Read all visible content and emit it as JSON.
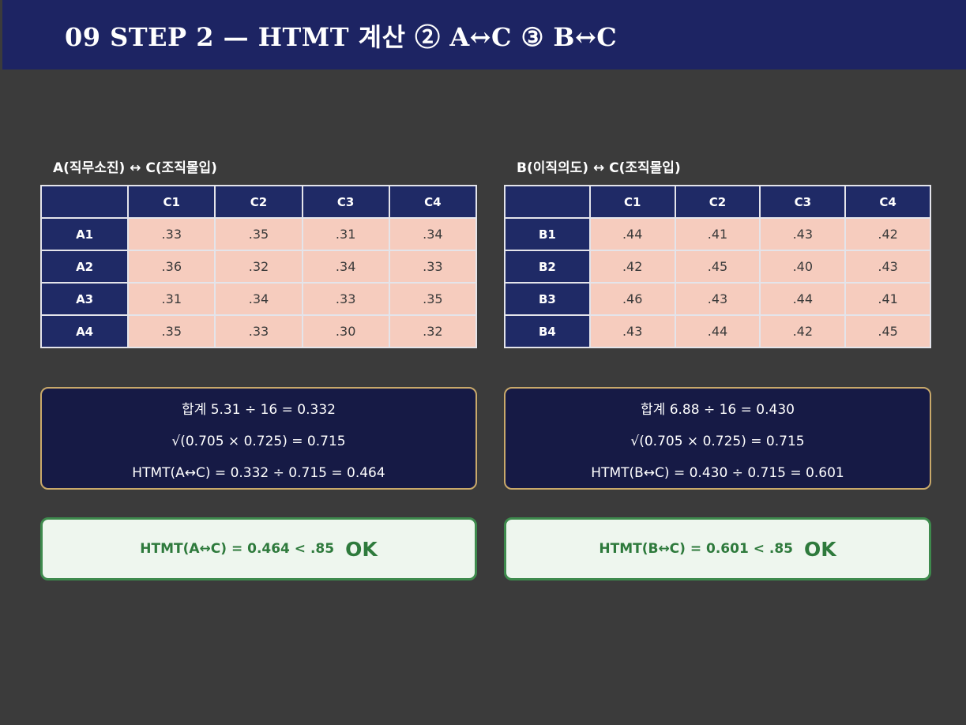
{
  "header": {
    "title": "09  STEP 2 — HTMT 계산 ②  A↔C   ③ B↔C",
    "background": "#1d2463"
  },
  "panels": [
    {
      "title": "A(직무소진) ↔ C(조직몰입)",
      "columns": [
        "",
        "C1",
        "C2",
        "C3",
        "C4"
      ],
      "rows": [
        {
          "label": "A1",
          "values": [
            ".33",
            ".35",
            ".31",
            ".34"
          ]
        },
        {
          "label": "A2",
          "values": [
            ".36",
            ".32",
            ".34",
            ".33"
          ]
        },
        {
          "label": "A3",
          "values": [
            ".31",
            ".34",
            ".33",
            ".35"
          ]
        },
        {
          "label": "A4",
          "values": [
            ".35",
            ".33",
            ".30",
            ".32"
          ]
        }
      ],
      "calc": [
        "합계 5.31  ÷  16 = 0.332",
        "√(0.705 × 0.725) = 0.715",
        "HTMT(A↔C) = 0.332 ÷ 0.715 = 0.464"
      ],
      "verdict": "HTMT(A↔C) = 0.464  <  .85",
      "ok": "OK"
    },
    {
      "title": "B(이직의도) ↔ C(조직몰입)",
      "columns": [
        "",
        "C1",
        "C2",
        "C3",
        "C4"
      ],
      "rows": [
        {
          "label": "B1",
          "values": [
            ".44",
            ".41",
            ".43",
            ".42"
          ]
        },
        {
          "label": "B2",
          "values": [
            ".42",
            ".45",
            ".40",
            ".43"
          ]
        },
        {
          "label": "B3",
          "values": [
            ".46",
            ".43",
            ".44",
            ".41"
          ]
        },
        {
          "label": "B4",
          "values": [
            ".43",
            ".44",
            ".42",
            ".45"
          ]
        }
      ],
      "calc": [
        "합계 6.88  ÷  16 = 0.430",
        "√(0.705 × 0.725) = 0.715",
        "HTMT(B↔C) = 0.430 ÷ 0.715 = 0.601"
      ],
      "verdict": "HTMT(B↔C) = 0.601  <  .85",
      "ok": "OK"
    }
  ],
  "colors": {
    "page_background": "#3b3b3b",
    "table_header": "#1f2a66",
    "table_cell": "#f6ccbe",
    "calc_box": "#161a45",
    "calc_border": "#c9a96a",
    "verdict_fill": "#eef6ee",
    "verdict_green": "#2e7a3c"
  }
}
